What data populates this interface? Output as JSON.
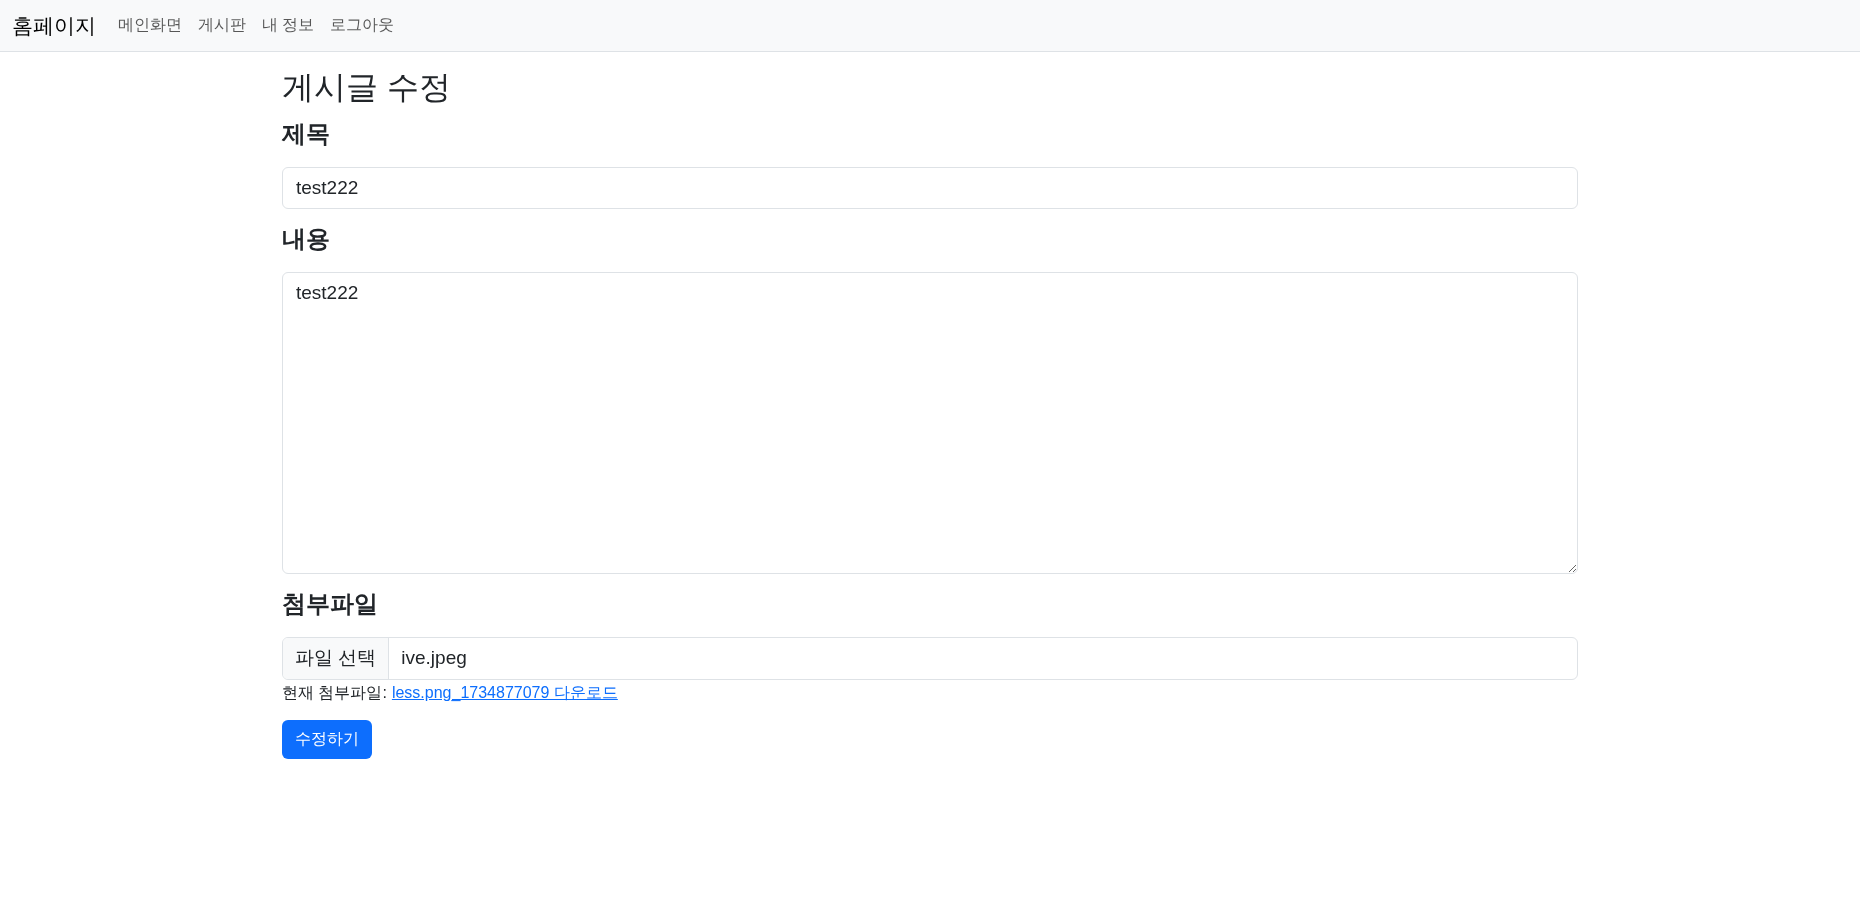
{
  "navbar": {
    "brand": "홈페이지",
    "links": [
      "메인화면",
      "게시판",
      "내 정보",
      "로그아웃"
    ]
  },
  "page_title": "게시글 수정",
  "form": {
    "title_label": "제목",
    "title_value": "test222",
    "content_label": "내용",
    "content_value": "test222",
    "attachment_label": "첨부파일",
    "file_button": "파일 선택",
    "file_name": "ive.jpeg",
    "current_file_label": "현재 첨부파일:",
    "current_file_link": "less.png_1734877079 다운로드",
    "submit": "수정하기"
  }
}
